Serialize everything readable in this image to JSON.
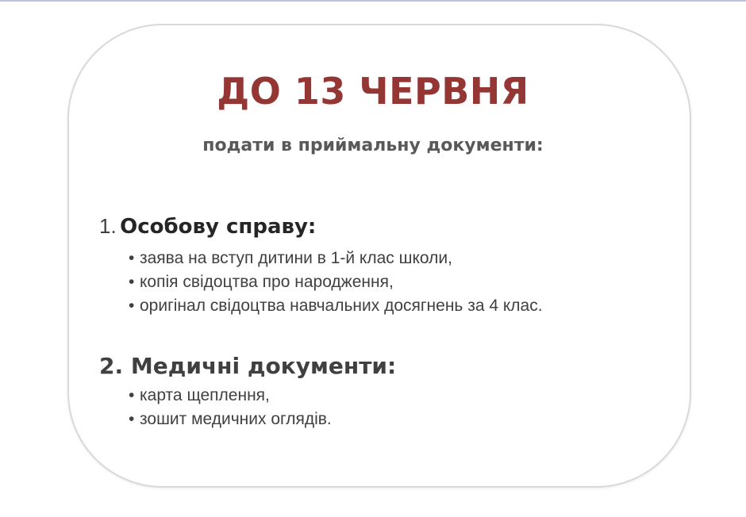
{
  "slide": {
    "title": "ДО 13 ЧЕРВНЯ",
    "subtitle": "подати в приймальну документи:",
    "sections": [
      {
        "number": "1.",
        "heading": "Особову справу:",
        "items": [
          "заява на вступ дитини в 1-й клас школи,",
          "копія свідоцтва про народження,",
          "оригінал свідоцтва навчальних досягнень за 4 клас."
        ]
      },
      {
        "heading": "2. Медичні документи:",
        "items": [
          "карта щеплення,",
          "зошит медичних оглядів."
        ]
      }
    ],
    "bullet": "•"
  },
  "colors": {
    "title": "#943634",
    "text": "#404040",
    "card_border": "#d9d9d9"
  }
}
